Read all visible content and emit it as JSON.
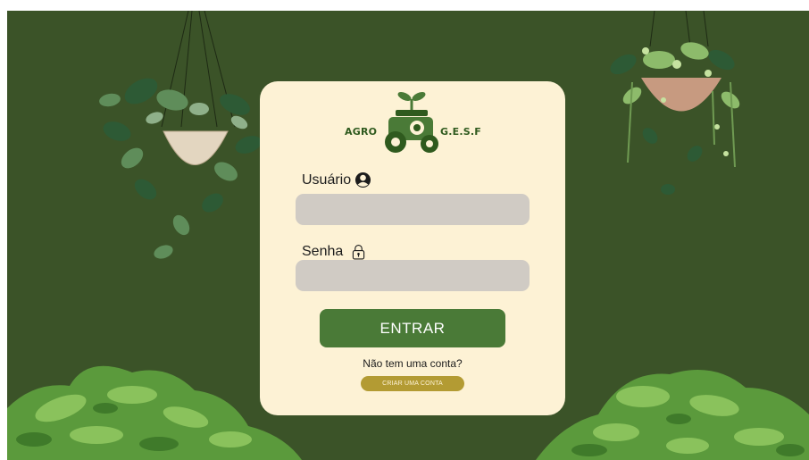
{
  "brand": {
    "left_word": "AGRO",
    "right_word": "G.E.S.F"
  },
  "login": {
    "username_label": "Usuário",
    "username_value": "",
    "password_label": "Senha",
    "password_value": "",
    "submit_label": "ENTRAR",
    "no_account_text": "Não tem uma conta?",
    "create_account_label": "CRIAR UMA CONTA"
  },
  "icons": {
    "username": "user-circle-icon",
    "password": "padlock-icon",
    "logo": "tractor-sprout-icon"
  },
  "colors": {
    "background": "#3b5328",
    "card": "#fdf2d5",
    "input": "#d0cbc4",
    "primary_button": "#4a7a37",
    "secondary_button": "#b39b33",
    "logo_green": "#2f5a1e"
  }
}
